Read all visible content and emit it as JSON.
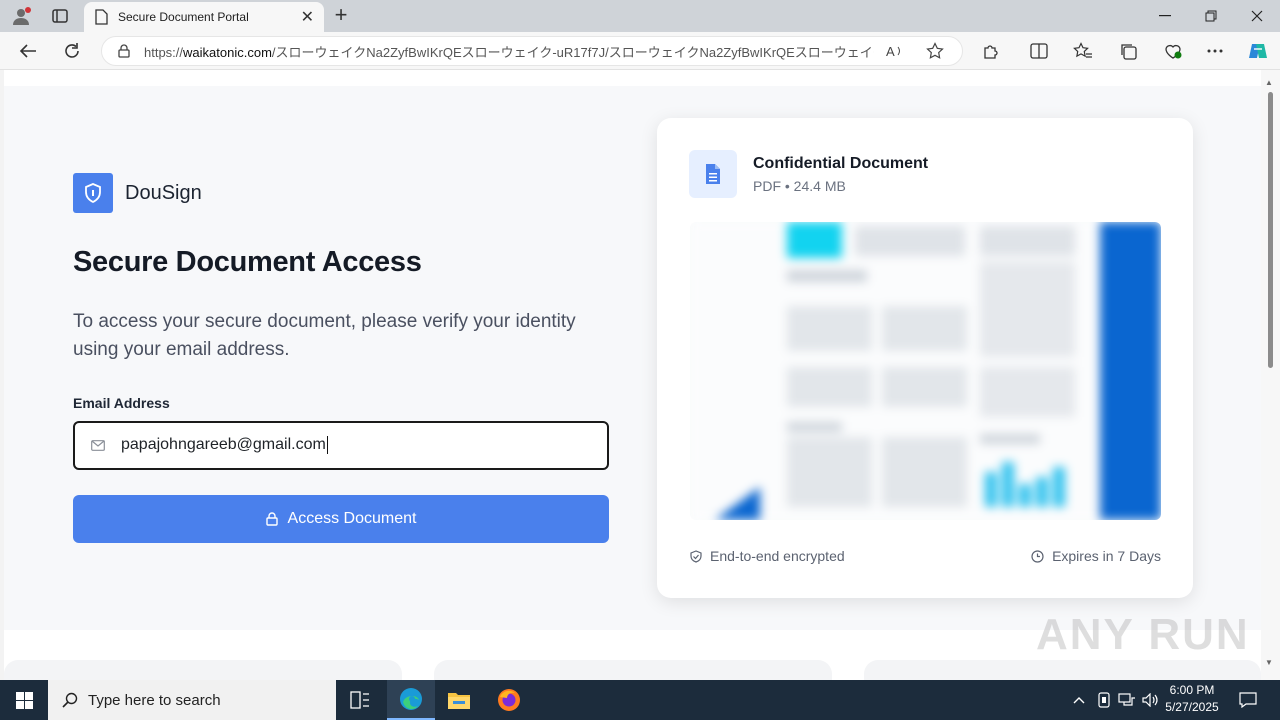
{
  "browser": {
    "tab_title": "Secure Document Portal",
    "url_prefix": "https://",
    "url_host": "waikatonic.com",
    "url_rest": "/スローウェイクNa2ZyfBwIKrQEスローウェイク-uR17f7J/スローウェイクNa2ZyfBwIKrQEスローウェイク-uR17f...",
    "close_glyph": "✕",
    "new_tab_glyph": "+"
  },
  "brand": {
    "name": "DouSign",
    "color": "#4a80ec"
  },
  "main": {
    "headline": "Secure Document Access",
    "description": "To access your secure document, please verify your identity using your email address.",
    "email_label": "Email Address",
    "email_value": "papajohngareeb@gmail.com",
    "access_button": "Access Document"
  },
  "document_card": {
    "title": "Confidential Document",
    "meta": "PDF • 24.4 MB",
    "footer_left": "End-to-end encrypted",
    "footer_right": "Expires in 7 Days"
  },
  "watermark": "ANY RUN",
  "taskbar": {
    "search_placeholder": "Type here to search",
    "time": "6:00 PM",
    "date": "5/27/2025"
  }
}
